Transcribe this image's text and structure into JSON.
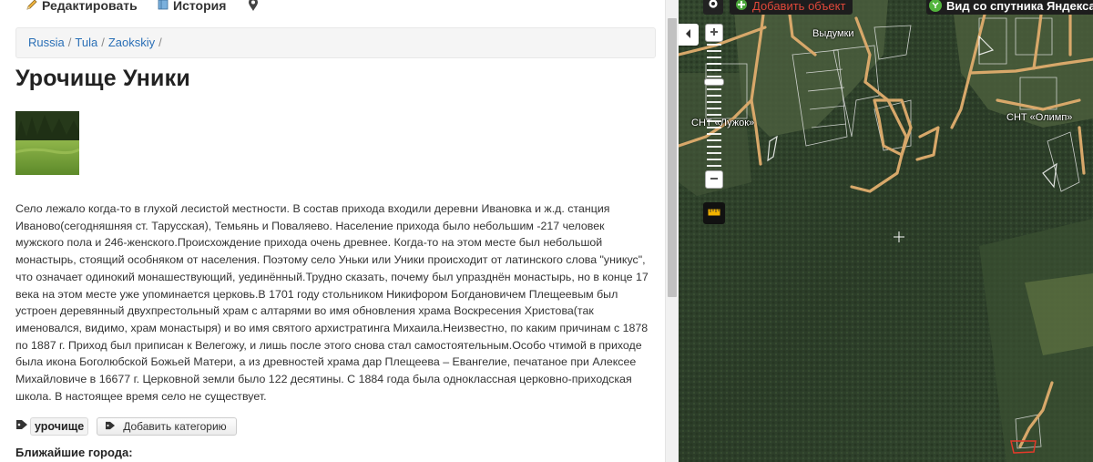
{
  "toolbar": {
    "edit_label": "Редактировать",
    "history_label": "История"
  },
  "breadcrumb": [
    "Russia",
    "Tula",
    "Zaokskiy"
  ],
  "page": {
    "title": "Урочище Уники",
    "description": "Село лежало когда-то в глухой лесистой местности. В состав прихода входили деревни Ивановка и ж.д. станция Иваново(сегодняшняя ст. Тарусская), Темьянь и Поваляево. Население прихода было небольшим -217 человек мужского пола и 246-женского.Происхождение прихода очень древнее. Когда-то на этом месте был небольшой монастырь, стоящий особняком от населения. Поэтому село Уньки или Уники происходит от латинского слова \"уникус\", что означает одинокий монашествующий, уединённый.Трудно сказать, почему был упразднён монастырь, но в конце 17 века на этом месте уже упоминается церковь.В 1701 году стольником Никифором Богдановичем Плещеевым был устроен деревянный двухпрестольный храм с алтарями во имя обновления храма Воскресения Христова(так именовался, видимо, храм монастыря) и во имя святого архистратинга Михаила.Неизвестно, по каким причинам с 1878 по 1887 г. Приход был приписан к Велегожу, и лишь после этого снова стал самостоятельным.Особо чтимой в приходе была икона Боголюбской Божьей Матери, а из древностей храма дар Плещеева – Евангелие, печатаное при Алексее Михайловиче в 16677 г. Церковной земли было 122 десятины. С 1884 года была одноклассная церковно-приходская школа. В настоящее время село не существует.",
    "tag": "урочище",
    "add_category_label": "Добавить категорию",
    "nearby_title": "Ближайшие города:"
  },
  "map": {
    "add_object_label": "Добавить объект",
    "satellite_label": "Вид со спутника Яндекса",
    "labels": {
      "vydumki": "Выдумки",
      "snt_luzhok": "СНТ «Лужок»",
      "snt_olimp": "СНТ «Олимп»"
    }
  },
  "colors": {
    "link": "#2a6fb6",
    "add_object_text": "#e0483a",
    "satellite_dot": "#52b43c",
    "road": "#d8a86a"
  },
  "icons": [
    "pencil-icon",
    "book-icon",
    "map-pin-icon",
    "tag-icon",
    "gear-icon",
    "chevron-left-icon",
    "plus-icon",
    "minus-icon",
    "ruler-icon",
    "crosshair-icon"
  ]
}
